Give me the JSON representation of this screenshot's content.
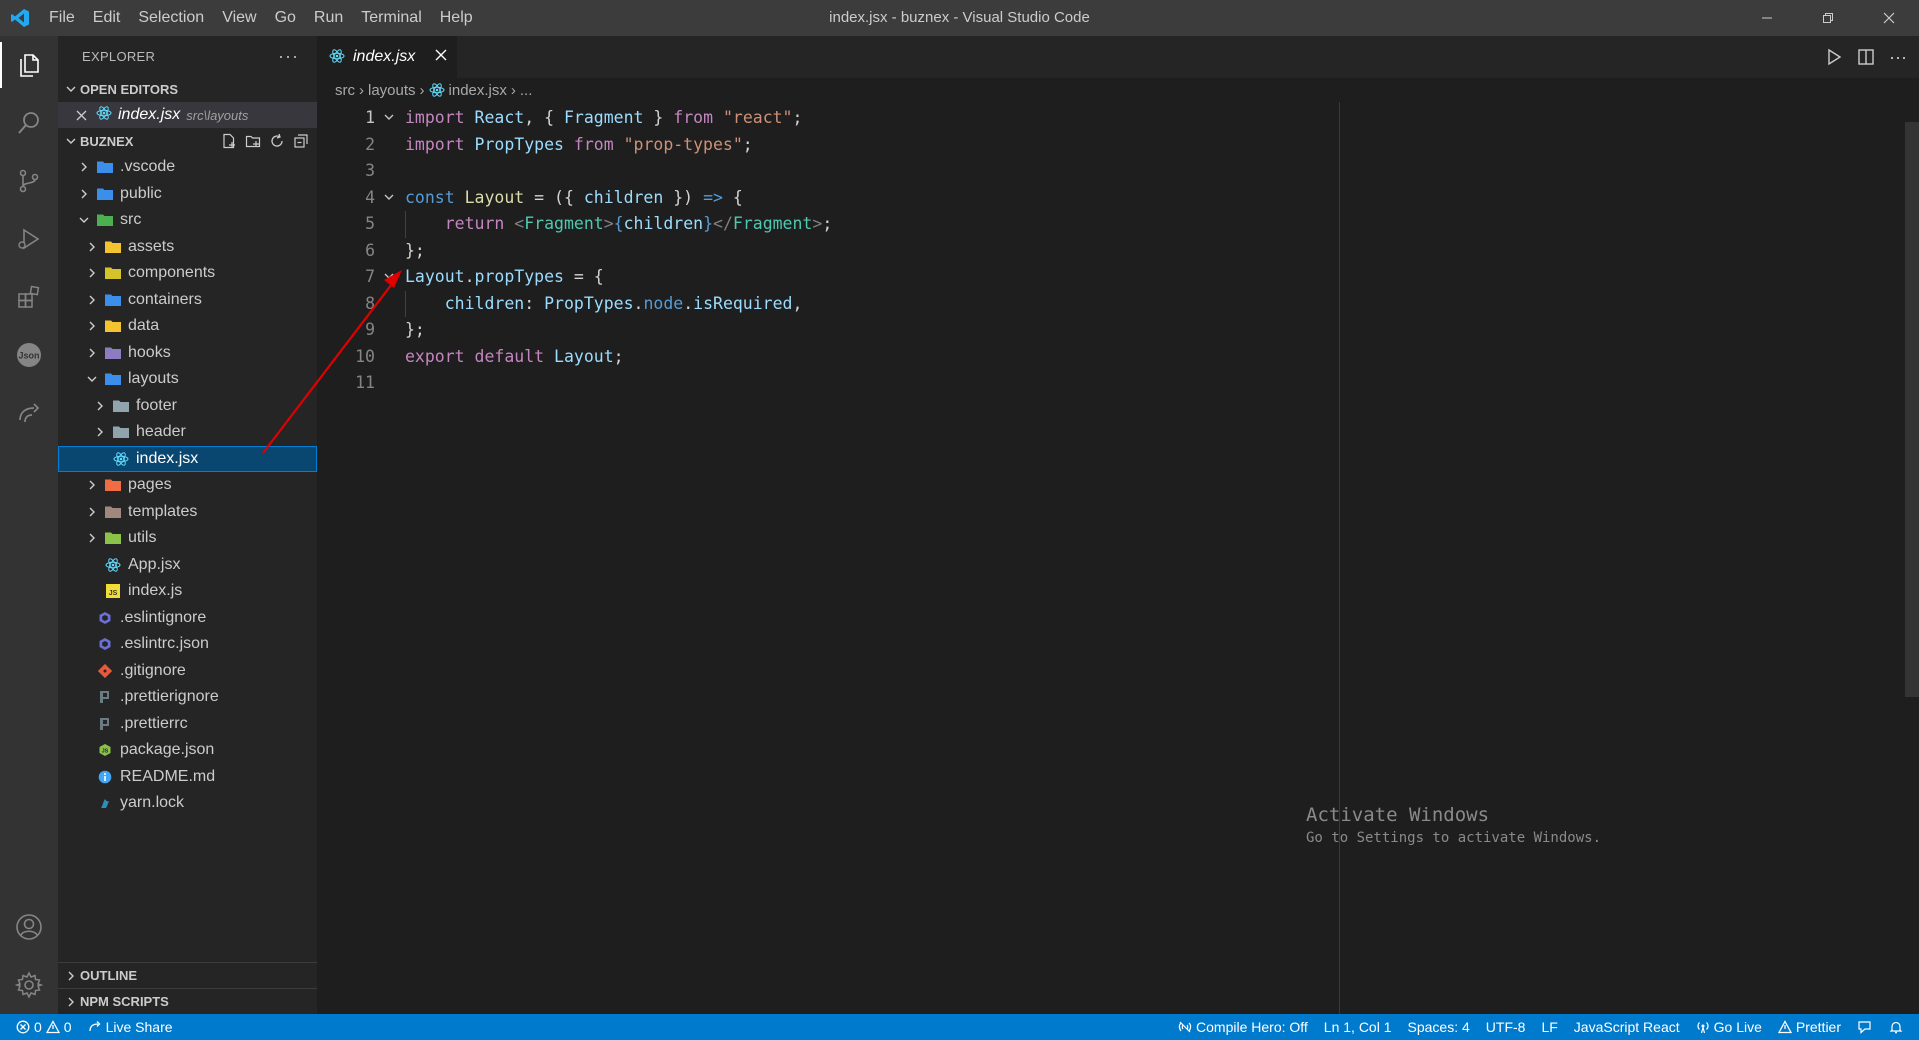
{
  "window": {
    "title": "index.jsx - buznex - Visual Studio Code",
    "menu": [
      "File",
      "Edit",
      "Selection",
      "View",
      "Go",
      "Run",
      "Terminal",
      "Help"
    ]
  },
  "sidebar": {
    "header": "EXPLORER",
    "open_editors_label": "OPEN EDITORS",
    "open_editor": {
      "name": "index.jsx",
      "path": "src\\layouts"
    },
    "project_label": "BUZNEX",
    "tree": [
      {
        "name": ".vscode",
        "type": "folder",
        "expanded": false,
        "depth": 0,
        "color": "#3b8eea"
      },
      {
        "name": "public",
        "type": "folder",
        "expanded": false,
        "depth": 0,
        "color": "#3b8eea"
      },
      {
        "name": "src",
        "type": "folder",
        "expanded": true,
        "depth": 0,
        "color": "#4caf50"
      },
      {
        "name": "assets",
        "type": "folder",
        "expanded": false,
        "depth": 1,
        "color": "#f4c430"
      },
      {
        "name": "components",
        "type": "folder",
        "expanded": false,
        "depth": 1,
        "color": "#d4c32a"
      },
      {
        "name": "containers",
        "type": "folder",
        "expanded": false,
        "depth": 1,
        "color": "#3b8eea"
      },
      {
        "name": "data",
        "type": "folder",
        "expanded": false,
        "depth": 1,
        "color": "#f4c430"
      },
      {
        "name": "hooks",
        "type": "folder",
        "expanded": false,
        "depth": 1,
        "color": "#8e7cc3"
      },
      {
        "name": "layouts",
        "type": "folder",
        "expanded": true,
        "depth": 1,
        "color": "#3b8eea"
      },
      {
        "name": "footer",
        "type": "folder",
        "expanded": false,
        "depth": 2,
        "color": "#90a4ae"
      },
      {
        "name": "header",
        "type": "folder",
        "expanded": false,
        "depth": 2,
        "color": "#90a4ae"
      },
      {
        "name": "index.jsx",
        "type": "react",
        "depth": 2,
        "selected": true
      },
      {
        "name": "pages",
        "type": "folder",
        "expanded": false,
        "depth": 1,
        "color": "#ef6c45"
      },
      {
        "name": "templates",
        "type": "folder",
        "expanded": false,
        "depth": 1,
        "color": "#a1887f"
      },
      {
        "name": "utils",
        "type": "folder",
        "expanded": false,
        "depth": 1,
        "color": "#8bc34a"
      },
      {
        "name": "App.jsx",
        "type": "react",
        "depth": 1
      },
      {
        "name": "index.js",
        "type": "js",
        "depth": 1
      },
      {
        "name": ".eslintignore",
        "type": "eslint",
        "depth": 0
      },
      {
        "name": ".eslintrc.json",
        "type": "eslint",
        "depth": 0
      },
      {
        "name": ".gitignore",
        "type": "git",
        "depth": 0
      },
      {
        "name": ".prettierignore",
        "type": "prettier",
        "depth": 0
      },
      {
        "name": ".prettierrc",
        "type": "prettier",
        "depth": 0
      },
      {
        "name": "package.json",
        "type": "node",
        "depth": 0
      },
      {
        "name": "README.md",
        "type": "info",
        "depth": 0
      },
      {
        "name": "yarn.lock",
        "type": "yarn",
        "depth": 0
      }
    ],
    "outline_label": "OUTLINE",
    "npm_label": "NPM SCRIPTS"
  },
  "editor": {
    "tab_label": "index.jsx",
    "breadcrumb": [
      "src",
      "layouts",
      "index.jsx",
      "..."
    ],
    "lines": [
      {
        "n": "1",
        "fold": true,
        "tokens": [
          [
            "kw",
            "import"
          ],
          [
            "pun",
            " "
          ],
          [
            "var",
            "React"
          ],
          [
            "pun",
            ", { "
          ],
          [
            "var",
            "Fragment"
          ],
          [
            "pun",
            " } "
          ],
          [
            "kw",
            "from"
          ],
          [
            "pun",
            " "
          ],
          [
            "str",
            "\"react\""
          ],
          [
            "pun",
            ";"
          ]
        ]
      },
      {
        "n": "2",
        "fold": false,
        "tokens": [
          [
            "kw",
            "import"
          ],
          [
            "pun",
            " "
          ],
          [
            "var",
            "PropTypes"
          ],
          [
            "pun",
            " "
          ],
          [
            "kw",
            "from"
          ],
          [
            "pun",
            " "
          ],
          [
            "str",
            "\"prop-types\""
          ],
          [
            "pun",
            ";"
          ]
        ]
      },
      {
        "n": "3",
        "fold": false,
        "tokens": []
      },
      {
        "n": "4",
        "fold": true,
        "tokens": [
          [
            "kw2",
            "const"
          ],
          [
            "pun",
            " "
          ],
          [
            "fn",
            "Layout"
          ],
          [
            "pun",
            " = ({ "
          ],
          [
            "var",
            "children"
          ],
          [
            "pun",
            " }) "
          ],
          [
            "kw2",
            "=>"
          ],
          [
            "pun",
            " {"
          ]
        ]
      },
      {
        "n": "5",
        "fold": false,
        "tokens": [
          [
            "pun",
            "    "
          ],
          [
            "kw",
            "return"
          ],
          [
            "pun",
            " "
          ],
          [
            "tag",
            "<"
          ],
          [
            "cls",
            "Fragment"
          ],
          [
            "tag",
            ">"
          ],
          [
            "kw2",
            "{"
          ],
          [
            "var",
            "children"
          ],
          [
            "kw2",
            "}"
          ],
          [
            "tag",
            "</"
          ],
          [
            "cls",
            "Fragment"
          ],
          [
            "tag",
            ">"
          ],
          [
            "pun",
            ";"
          ]
        ]
      },
      {
        "n": "6",
        "fold": false,
        "tokens": [
          [
            "pun",
            "};"
          ]
        ]
      },
      {
        "n": "7",
        "fold": true,
        "tokens": [
          [
            "var",
            "Layout"
          ],
          [
            "pun",
            "."
          ],
          [
            "var",
            "propTypes"
          ],
          [
            "pun",
            " = {"
          ]
        ]
      },
      {
        "n": "8",
        "fold": false,
        "tokens": [
          [
            "pun",
            "    "
          ],
          [
            "var",
            "children"
          ],
          [
            "pun",
            ": "
          ],
          [
            "var",
            "PropTypes"
          ],
          [
            "pun",
            "."
          ],
          [
            "kw2",
            "node"
          ],
          [
            "pun",
            "."
          ],
          [
            "var",
            "isRequired"
          ],
          [
            "pun",
            ","
          ]
        ]
      },
      {
        "n": "9",
        "fold": false,
        "tokens": [
          [
            "pun",
            "};"
          ]
        ]
      },
      {
        "n": "10",
        "fold": false,
        "tokens": [
          [
            "kw",
            "export"
          ],
          [
            "pun",
            " "
          ],
          [
            "kw",
            "default"
          ],
          [
            "pun",
            " "
          ],
          [
            "var",
            "Layout"
          ],
          [
            "pun",
            ";"
          ]
        ]
      },
      {
        "n": "11",
        "fold": false,
        "tokens": []
      }
    ],
    "current_line": "1"
  },
  "watermark": {
    "title": "Activate Windows",
    "subtitle": "Go to Settings to activate Windows."
  },
  "statusbar": {
    "errors": "0",
    "warnings": "0",
    "live_share": "Live Share",
    "compile_hero": "Compile Hero: Off",
    "position": "Ln 1, Col 1",
    "spaces": "Spaces: 4",
    "encoding": "UTF-8",
    "eol": "LF",
    "language": "JavaScript React",
    "go_live": "Go Live",
    "prettier": "Prettier"
  },
  "colors": {
    "accent": "#007acc",
    "annotation_arrow": "#e00000"
  }
}
